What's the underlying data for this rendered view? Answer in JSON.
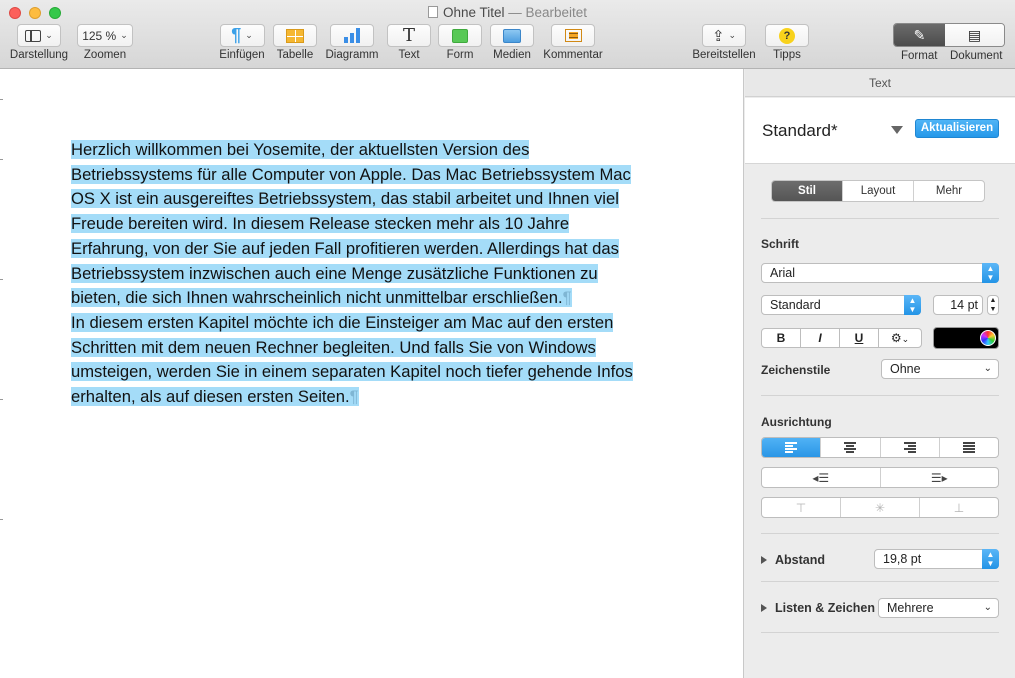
{
  "window": {
    "title": "Ohne Titel",
    "separator": "—",
    "status": "Bearbeitet"
  },
  "toolbar": {
    "view_label": "Darstellung",
    "zoom_value": "125 %",
    "zoom_label": "Zoomen",
    "insert_label": "Einfügen",
    "insert_icon": "¶",
    "table_label": "Tabelle",
    "chart_label": "Diagramm",
    "text_label": "Text",
    "text_icon": "T",
    "shape_label": "Form",
    "media_label": "Medien",
    "comment_label": "Kommentar",
    "share_label": "Bereitstellen",
    "tips_label": "Tipps",
    "tips_icon": "?",
    "format_label": "Format",
    "document_label": "Dokument"
  },
  "document": {
    "paragraphs": [
      "Herzlich willkommen bei Yosemite, der aktuellsten Version des Betriebssystems für alle Computer von Apple. Das Mac Betriebssystem Mac OS X ist ein ausgereiftes Betriebssystem, das stabil arbeitet und Ihnen viel Freude bereiten wird. In diesem Release stecken mehr als 10 Jahre Erfahrung, von der Sie auf jeden Fall profitieren werden. Allerdings hat das Betriebssystem inzwischen auch eine Menge zusätzliche Funktionen zu bieten, die sich Ihnen wahrscheinlich nicht unmittelbar erschließen.",
      "In diesem ersten Kapitel möchte ich die Einsteiger am Mac auf den ersten Schritten mit dem neuen Rechner begleiten. Und falls Sie von Windows umsteigen, werden Sie in einem separaten Kapitel noch tiefer gehende Infos erhalten, als auf diesen ersten Seiten."
    ],
    "pilcrow": "¶",
    "selection_color": "#a4dcf8"
  },
  "inspector": {
    "header": "Text",
    "paragraph_style": "Standard*",
    "update_button": "Aktualisieren",
    "tabs": [
      "Stil",
      "Layout",
      "Mehr"
    ],
    "active_tab": "Stil",
    "font_section": "Schrift",
    "font_family": "Arial",
    "font_typeface": "Standard",
    "font_size": "14 pt",
    "bold": "B",
    "italic": "I",
    "underline": "U",
    "gear": "⚙",
    "text_color": "#000000",
    "char_styles_label": "Zeichenstile",
    "char_styles_value": "Ohne",
    "alignment_section": "Ausrichtung",
    "spacing_label": "Abstand",
    "spacing_value": "19,8 pt",
    "lists_label": "Listen & Zeichen",
    "lists_value": "Mehrere",
    "accent_color": "#2a96e6"
  }
}
